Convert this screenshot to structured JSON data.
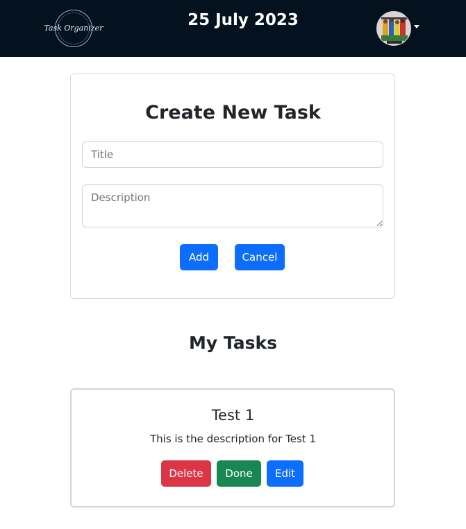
{
  "header": {
    "logo_text": "Task Organizer",
    "date": "25 July 2023"
  },
  "create_task": {
    "heading": "Create New Task",
    "title_placeholder": "Title",
    "title_value": "",
    "description_placeholder": "Description",
    "description_value": "",
    "add_label": "Add",
    "cancel_label": "Cancel"
  },
  "tasks_section": {
    "heading": "My Tasks",
    "tasks": [
      {
        "title": "Test 1",
        "description": "This is the description for Test 1",
        "delete_label": "Delete",
        "done_label": "Done",
        "edit_label": "Edit"
      }
    ]
  },
  "colors": {
    "navbar": "#04111f",
    "primary": "#0d6efd",
    "danger": "#dc3545",
    "success": "#198754"
  },
  "icons": {
    "avatar": "user-avatar",
    "caret": "caret-down-icon"
  }
}
